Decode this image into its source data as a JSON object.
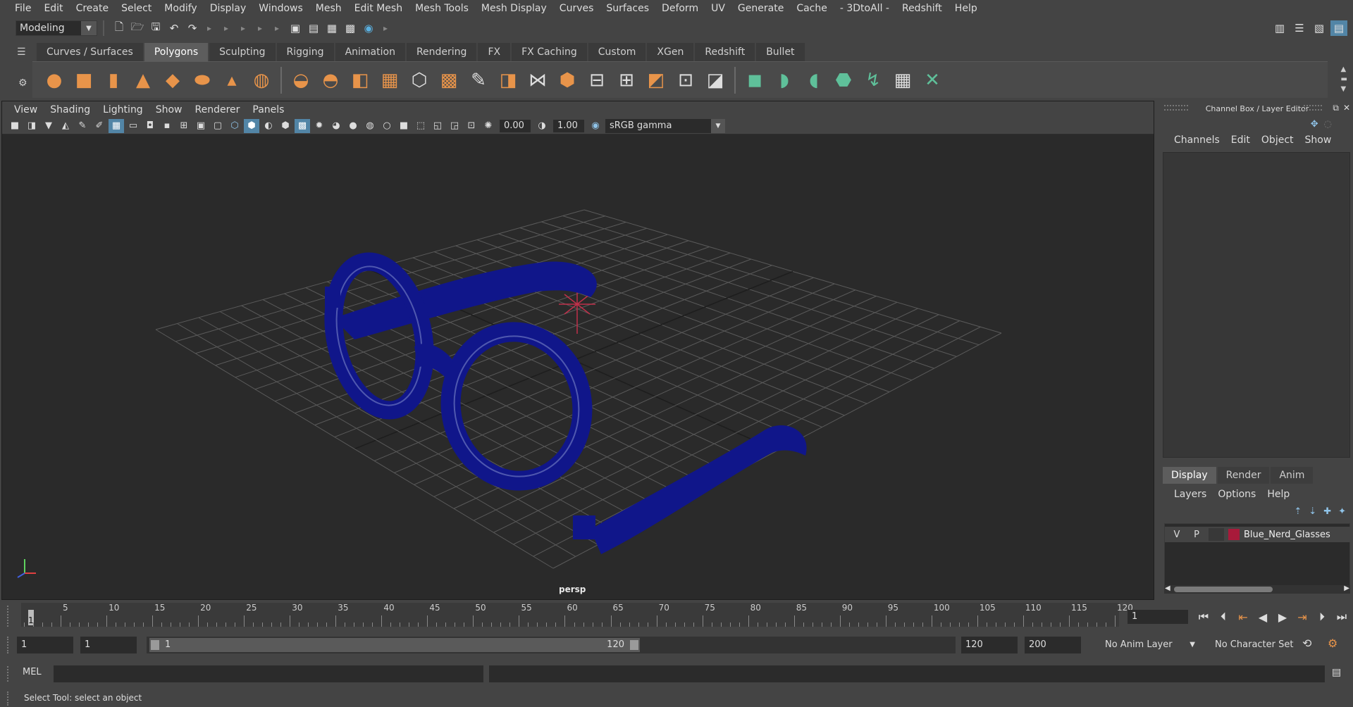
{
  "menubar": [
    "File",
    "Edit",
    "Create",
    "Select",
    "Modify",
    "Display",
    "Windows",
    "Mesh",
    "Edit Mesh",
    "Mesh Tools",
    "Mesh Display",
    "Curves",
    "Surfaces",
    "Deform",
    "UV",
    "Generate",
    "Cache",
    "- 3DtoAll -",
    "Redshift",
    "Help"
  ],
  "statusline": {
    "mode": "Modeling"
  },
  "shelf": {
    "tabs": [
      "Curves / Surfaces",
      "Polygons",
      "Sculpting",
      "Rigging",
      "Animation",
      "Rendering",
      "FX",
      "FX Caching",
      "Custom",
      "XGen",
      "Redshift",
      "Bullet"
    ],
    "active_tab": "Polygons"
  },
  "viewport": {
    "menu": [
      "View",
      "Shading",
      "Lighting",
      "Show",
      "Renderer",
      "Panels"
    ],
    "exposure": "0.00",
    "gamma": "1.00",
    "color_space": "sRGB gamma",
    "camera_label": "persp",
    "object_color": "#10168a"
  },
  "channelbox": {
    "title": "Channel Box / Layer Editor",
    "menu": [
      "Channels",
      "Edit",
      "Object",
      "Show"
    ]
  },
  "layereditor": {
    "tabs": [
      "Display",
      "Render",
      "Anim"
    ],
    "active_tab": "Display",
    "menu": [
      "Layers",
      "Options",
      "Help"
    ],
    "layers": [
      {
        "v": "V",
        "p": "P",
        "name": "Blue_Nerd_Glasses",
        "color": "#a81a3a"
      }
    ]
  },
  "timeslider": {
    "ticks": [
      5,
      10,
      15,
      20,
      25,
      30,
      35,
      40,
      45,
      50,
      55,
      60,
      65,
      70,
      75,
      80,
      85,
      90,
      95,
      100,
      105,
      110,
      115,
      120
    ],
    "current_frame": "1",
    "frame_field": "1"
  },
  "range": {
    "start": "1",
    "playback_start": "1",
    "slider_start": "1",
    "slider_end": "120",
    "playback_end": "120",
    "end": "200",
    "anim_layer": "No Anim Layer",
    "character_set": "No Character Set"
  },
  "commandline": {
    "label": "MEL"
  },
  "helpline": {
    "text": "Select Tool: select an object"
  }
}
